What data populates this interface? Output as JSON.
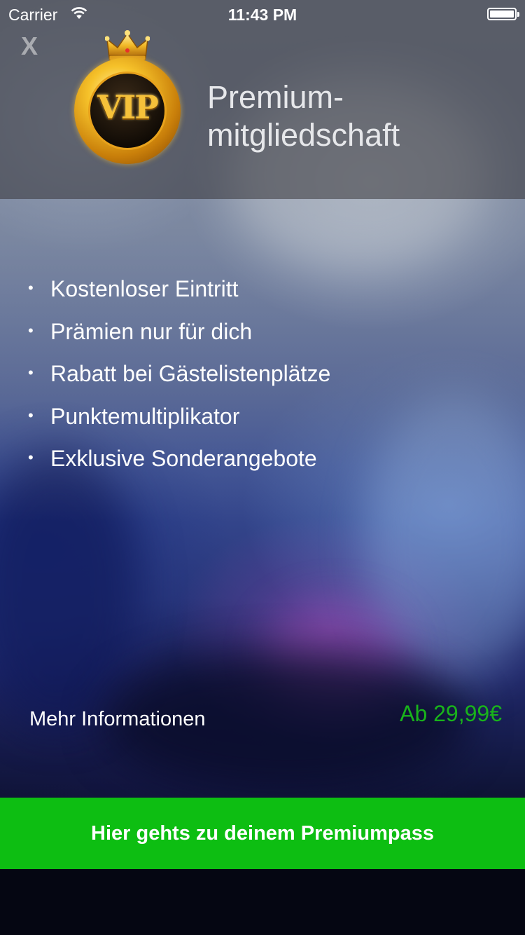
{
  "status_bar": {
    "carrier": "Carrier",
    "time": "11:43 PM",
    "wifi_icon": "wifi-icon",
    "battery_icon": "battery-icon"
  },
  "header": {
    "close_label": "X",
    "badge_text": "VIP",
    "title_line1": "Premium-",
    "title_line2": "mitgliedschaft"
  },
  "features": [
    {
      "bullet": "•",
      "label": "Kostenloser Eintritt"
    },
    {
      "bullet": "•",
      "label": "Prämien nur für dich"
    },
    {
      "bullet": "•",
      "label": "Rabatt bei Gästelistenplätze"
    },
    {
      "bullet": "•",
      "label": "Punktemultiplikator"
    },
    {
      "bullet": "•",
      "label": "Exklusive Sonderangebote"
    }
  ],
  "footer": {
    "more_info_label": "Mehr Informationen",
    "price_label": "Ab 29,99€",
    "cta_label": "Hier gehts zu deinem Premiumpass"
  },
  "colors": {
    "accent_green": "#0dbe12",
    "price_green": "#19b31b",
    "header_overlay": "#505054"
  }
}
